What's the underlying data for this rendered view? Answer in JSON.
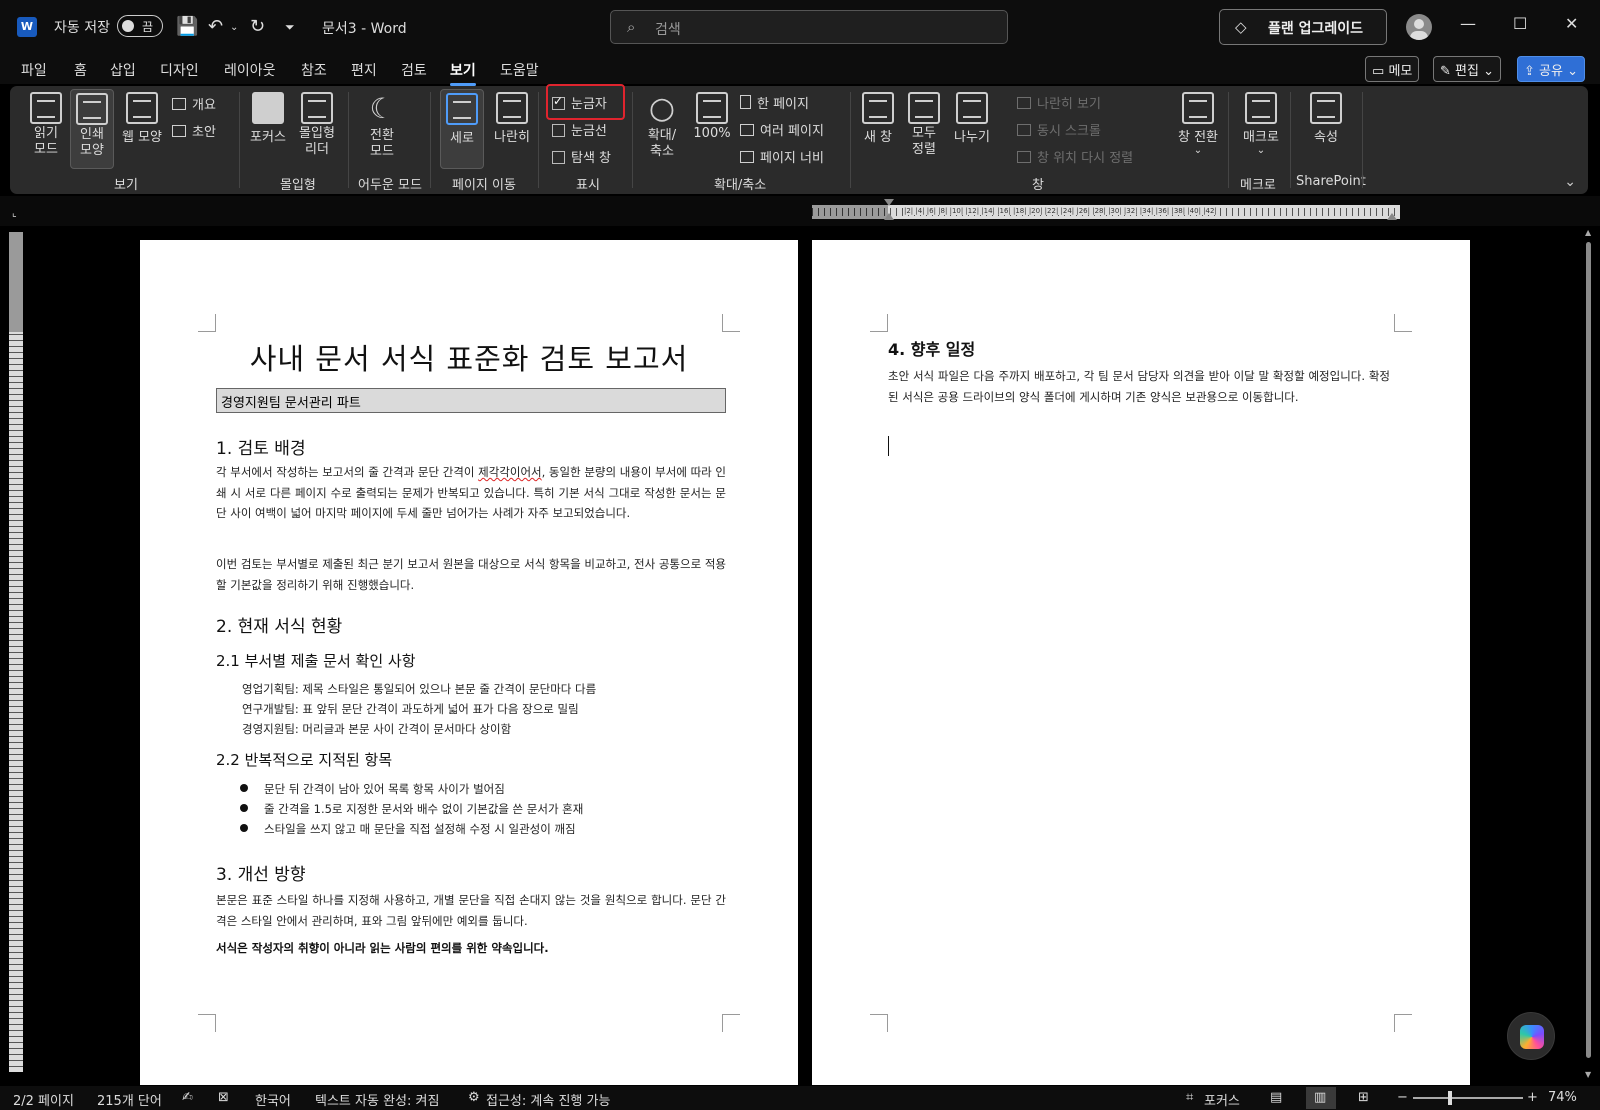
{
  "titlebar": {
    "autosave_label": "자동 저장",
    "autosave_state": "끔",
    "doc_title": "문서3  -  Word",
    "search_placeholder": "검색",
    "upgrade_label": "플랜 업그레이드"
  },
  "menu": {
    "tabs": [
      "파일",
      "홈",
      "삽입",
      "디자인",
      "레이아웃",
      "참조",
      "편지",
      "검토",
      "보기",
      "도움말"
    ],
    "active_tab": "보기",
    "memo_label": "메모",
    "edit_label": "편집",
    "share_label": "공유"
  },
  "ribbon": {
    "groups": {
      "view": "보기",
      "immersive": "몰입형",
      "dark_mode": "어두운 모드",
      "page_movement": "페이지 이동",
      "show": "표시",
      "zoom": "확대/축소",
      "window": "창",
      "macros": "메크로",
      "sharepoint": "SharePoint"
    },
    "buttons": {
      "read_mode": "읽기 모드",
      "print_layout": "인쇄 모양",
      "web_layout": "웹 모양",
      "outline": "개요",
      "draft": "초안",
      "focus": "포커스",
      "immersive_reader": "몰입형 리더",
      "switch_mode": "전환 모드",
      "vertical": "세로",
      "side_by_side": "나란히",
      "ruler": "눈금자",
      "gridlines": "눈금선",
      "nav_pane": "탐색 창",
      "zoom": "확대/ 축소",
      "zoom_100": "100%",
      "one_page": "한 페이지",
      "multiple_pages": "여러 페이지",
      "page_width": "페이지 너비",
      "new_window": "새 창",
      "arrange_all": "모두 정렬",
      "split": "나누기",
      "view_side_by_side": "나란히 보기",
      "sync_scroll": "동시 스크롤",
      "reset_position": "창 위치 다시 정렬",
      "switch_windows": "창 전환",
      "macros": "매크로",
      "properties": "속성"
    },
    "ruler_checked": true,
    "gridlines_checked": false,
    "nav_pane_checked": false
  },
  "page1": {
    "title": "사내 문서 서식 표준화 검토 보고서",
    "subtitle": "경영지원팀 문서관리 파트",
    "s1_heading": "1. 검토 배경",
    "s1_p1_a": "각 부서에서 작성하는 보고서의 줄 간격과 문단 간격이 ",
    "s1_p1_spell": "제각각이어서",
    "s1_p1_b": ", 동일한 분량의 내용이 부서에 따라 인쇄 시 서로 다른 페이지 수로 출력되는 문제가 반복되고 있습니다. 특히 기본 서식 그대로 작성한 문서는 문단 사이 여백이 넓어 마지막 페이지에 두세 줄만 넘어가는 사례가 자주 보고되었습니다.",
    "s1_p2": "이번 검토는 부서별로 제출된 최근 분기 보고서 원본을 대상으로 서식 항목을 비교하고, 전사 공통으로 적용할 기본값을 정리하기 위해 진행했습니다.",
    "s2_heading": "2. 현재 서식 현황",
    "s21_heading": "2.1 부서별 제출 문서 확인 사항",
    "s21_items": [
      "영업기획팀: 제목 스타일은 통일되어 있으나 본문 줄 간격이 문단마다 다름",
      "연구개발팀: 표 앞뒤 문단 간격이 과도하게 넓어 표가 다음 장으로 밀림",
      "경영지원팀: 머리글과 본문 사이 간격이 문서마다 상이함"
    ],
    "s22_heading": "2.2 반복적으로 지적된 항목",
    "s22_items": [
      "문단 뒤 간격이 남아 있어 목록 항목 사이가 벌어짐",
      "줄 간격을 1.5로 지정한 문서와 배수 없이 기본값을 쓴 문서가 혼재",
      "스타일을 쓰지 않고 매 문단을 직접 설정해 수정 시 일관성이 깨짐"
    ],
    "s3_heading": "3. 개선 방향",
    "s3_p1": "본문은 표준 스타일 하나를 지정해 사용하고, 개별 문단을 직접 손대지 않는 것을 원칙으로 합니다. 문단 간격은 스타일 안에서 관리하며, 표와 그림 앞뒤에만 예외를 둡니다.",
    "s3_bold": "서식은 작성자의 취향이 아니라 읽는 사람의 편의를 위한 약속입니다."
  },
  "page2": {
    "s4_heading": "4. 향후 일정",
    "s4_p1": "초안 서식 파일은 다음 주까지 배포하고, 각 팀 문서 담당자 의견을 받아 이달 말 확정할 예정입니다. 확정된 서식은 공용 드라이브의 양식 폴더에 게시하며 기존 양식은 보관용으로 이동합니다."
  },
  "ruler_numbers": "|2| |4| |6| |8| |10| |12| |14| |16| |18| |20| |22| |24| |26| |28| |30| |32| |34| |36| |38| |40| |42|",
  "statusbar": {
    "page": "2/2 페이지",
    "words": "215개 단어",
    "language": "한국어",
    "autocomplete": "텍스트 자동 완성: 켜짐",
    "accessibility": "접근성: 계속 진행 가능",
    "focus": "포커스",
    "zoom_minus": "−",
    "zoom_plus": "+",
    "zoom": "74%",
    "zoom_fraction": 0.74
  },
  "colors": {
    "accent": "#4f9cf9",
    "highlight_box": "#e0242e",
    "share_button": "#2f6fd6",
    "word_brand": "#185abd"
  }
}
